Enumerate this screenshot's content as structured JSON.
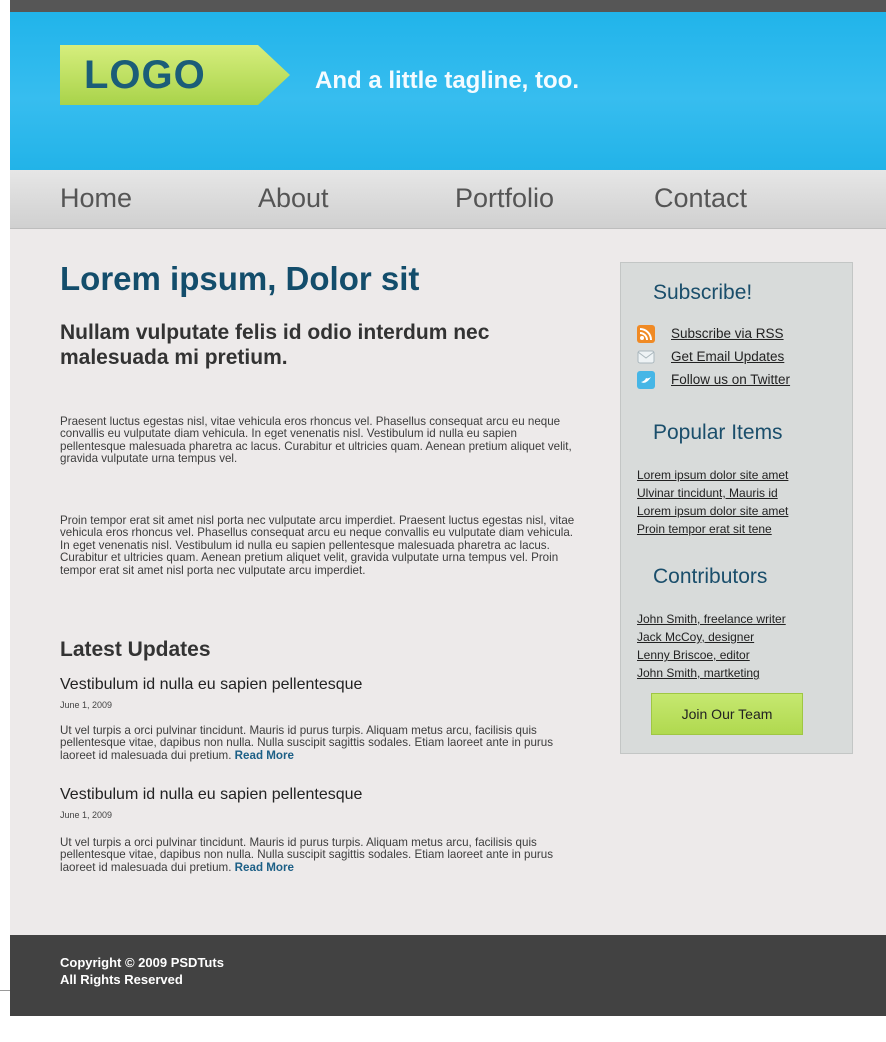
{
  "header": {
    "logo_text": "LOGO",
    "tagline": "And a little tagline, too."
  },
  "nav": {
    "items": [
      "Home",
      "About",
      "Portfolio",
      "Contact"
    ]
  },
  "main": {
    "title": "Lorem ipsum, Dolor sit",
    "lead": "Nullam vulputate felis id odio interdum nec malesuada mi pretium.",
    "paragraphs": [
      "Praesent luctus egestas nisl, vitae vehicula eros rhoncus vel. Phasellus consequat arcu eu neque convallis eu vulputate diam vehicula. In eget venenatis nisl. Vestibulum id nulla eu sapien pellentesque malesuada pharetra ac lacus. Curabitur et ultricies quam. Aenean pretium aliquet velit, gravida vulputate urna tempus vel.",
      "Proin tempor erat sit amet nisl porta nec vulputate arcu imperdiet. Praesent luctus egestas nisl, vitae vehicula eros rhoncus vel. Phasellus consequat arcu eu neque convallis eu vulputate diam vehicula. In eget venenatis nisl. Vestibulum id nulla eu sapien pellentesque malesuada pharetra ac lacus. Curabitur et ultricies quam. Aenean pretium aliquet velit, gravida vulputate urna tempus vel. Proin tempor erat sit amet nisl porta nec vulputate arcu imperdiet."
    ],
    "updates_heading": "Latest Updates",
    "posts": [
      {
        "title": "Vestibulum id nulla eu sapien pellentesque",
        "date": "June 1, 2009",
        "body": "Ut vel turpis a orci pulvinar tincidunt. Mauris id purus turpis. Aliquam metus arcu, facilisis quis pellentesque vitae, dapibus non nulla. Nulla suscipit sagittis sodales. Etiam laoreet ante in purus laoreet id malesuada dui pretium.",
        "read_more": "Read More"
      },
      {
        "title": "Vestibulum id nulla eu sapien pellentesque",
        "date": "June 1, 2009",
        "body": "Ut vel turpis a orci pulvinar tincidunt. Mauris id purus turpis. Aliquam metus arcu, facilisis quis pellentesque vitae, dapibus non nulla. Nulla suscipit sagittis sodales. Etiam laoreet ante in purus laoreet id malesuada dui pretium.",
        "read_more": "Read More"
      }
    ]
  },
  "sidebar": {
    "subscribe_heading": "Subscribe!",
    "subscribe_items": [
      {
        "label": "Subscribe via RSS",
        "icon": "rss-icon"
      },
      {
        "label": "Get Email Updates",
        "icon": "email-icon"
      },
      {
        "label": "Follow us on Twitter",
        "icon": "twitter-icon"
      }
    ],
    "popular_heading": "Popular Items",
    "popular_items": [
      "Lorem ipsum dolor site amet",
      "Ulvinar tincidunt, Mauris id",
      "Lorem ipsum dolor site amet",
      "Proin tempor erat sit tene"
    ],
    "contributors_heading": "Contributors",
    "contributors": [
      "John Smith, freelance writer",
      "Jack McCoy, designer",
      "Lenny Briscoe, editor",
      "John Smith, martketing"
    ],
    "join_button": "Join Our Team"
  },
  "footer": {
    "copyright": "Copyright © 2009 PSDTuts",
    "rights": "All Rights Reserved"
  },
  "colors": {
    "header_blue": "#22b3e8",
    "heading_blue": "#134d6b",
    "logo_green": "#b7dc5a",
    "footer_dark": "#424242"
  }
}
